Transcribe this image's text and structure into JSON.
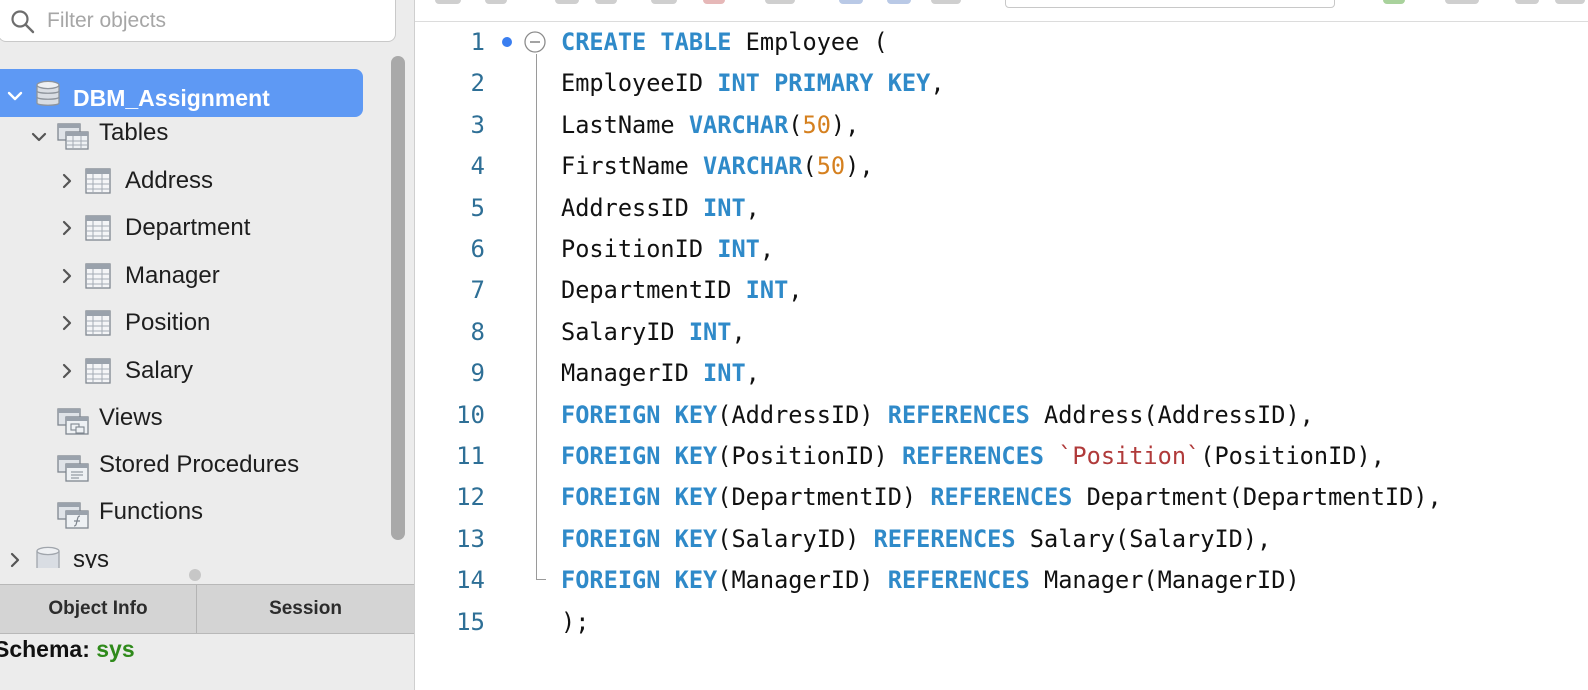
{
  "sidebar": {
    "filter_placeholder": "Filter objects",
    "tree": {
      "schema": "DBM_Assignment",
      "tables_label": "Tables",
      "tables": [
        "Address",
        "Department",
        "Manager",
        "Position",
        "Salary"
      ],
      "views_label": "Views",
      "procs_label": "Stored Procedures",
      "functions_label": "Functions",
      "sys_label": "sys"
    },
    "tabs": {
      "object_info": "Object Info",
      "session": "Session"
    },
    "info": {
      "schema_label": "Schema:",
      "schema_value": "sys"
    }
  },
  "editor": {
    "line_numbers": [
      "1",
      "2",
      "3",
      "4",
      "5",
      "6",
      "7",
      "8",
      "9",
      "10",
      "11",
      "12",
      "13",
      "14",
      "15"
    ],
    "lines": [
      [
        {
          "t": "CREATE TABLE",
          "c": "kw"
        },
        {
          "t": " Employee ("
        }
      ],
      [
        {
          "t": "EmployeeID "
        },
        {
          "t": "INT PRIMARY KEY",
          "c": "kw"
        },
        {
          "t": ","
        }
      ],
      [
        {
          "t": "LastName "
        },
        {
          "t": "VARCHAR",
          "c": "kw"
        },
        {
          "t": "("
        },
        {
          "t": "50",
          "c": "num"
        },
        {
          "t": "),"
        }
      ],
      [
        {
          "t": "FirstName "
        },
        {
          "t": "VARCHAR",
          "c": "kw"
        },
        {
          "t": "("
        },
        {
          "t": "50",
          "c": "num"
        },
        {
          "t": "),"
        }
      ],
      [
        {
          "t": "AddressID "
        },
        {
          "t": "INT",
          "c": "kw"
        },
        {
          "t": ","
        }
      ],
      [
        {
          "t": "PositionID "
        },
        {
          "t": "INT",
          "c": "kw"
        },
        {
          "t": ","
        }
      ],
      [
        {
          "t": "DepartmentID "
        },
        {
          "t": "INT",
          "c": "kw"
        },
        {
          "t": ","
        }
      ],
      [
        {
          "t": "SalaryID "
        },
        {
          "t": "INT",
          "c": "kw"
        },
        {
          "t": ","
        }
      ],
      [
        {
          "t": "ManagerID "
        },
        {
          "t": "INT",
          "c": "kw"
        },
        {
          "t": ","
        }
      ],
      [
        {
          "t": "FOREIGN KEY",
          "c": "kw"
        },
        {
          "t": "(AddressID) "
        },
        {
          "t": "REFERENCES",
          "c": "kw"
        },
        {
          "t": " Address(AddressID),"
        }
      ],
      [
        {
          "t": "FOREIGN KEY",
          "c": "kw"
        },
        {
          "t": "(PositionID) "
        },
        {
          "t": "REFERENCES",
          "c": "kw"
        },
        {
          "t": " "
        },
        {
          "t": "`Position`",
          "c": "str"
        },
        {
          "t": "(PositionID),"
        }
      ],
      [
        {
          "t": "FOREIGN KEY",
          "c": "kw"
        },
        {
          "t": "(DepartmentID) "
        },
        {
          "t": "REFERENCES",
          "c": "kw"
        },
        {
          "t": " Department(DepartmentID),"
        }
      ],
      [
        {
          "t": "FOREIGN KEY",
          "c": "kw"
        },
        {
          "t": "(SalaryID) "
        },
        {
          "t": "REFERENCES",
          "c": "kw"
        },
        {
          "t": " Salary(SalaryID),"
        }
      ],
      [
        {
          "t": "FOREIGN KEY",
          "c": "kw"
        },
        {
          "t": "(ManagerID) "
        },
        {
          "t": "REFERENCES",
          "c": "kw"
        },
        {
          "t": " Manager(ManagerID)"
        }
      ],
      [
        {
          "t": ");"
        }
      ]
    ]
  },
  "colors": {
    "selection": "#5e99f4",
    "keyword": "#2f8ac9",
    "number": "#d5801f",
    "string": "#b03a3a",
    "line_number": "#2e6f96",
    "schema_value": "#2f8a1b"
  },
  "icons": [
    "search-icon",
    "database-icon",
    "tables-folder-icon",
    "table-icon",
    "views-folder-icon",
    "procedures-folder-icon",
    "functions-folder-icon",
    "chevron-right-icon",
    "chevron-down-icon",
    "fold-collapse-icon",
    "breakpoint-dot-icon"
  ]
}
